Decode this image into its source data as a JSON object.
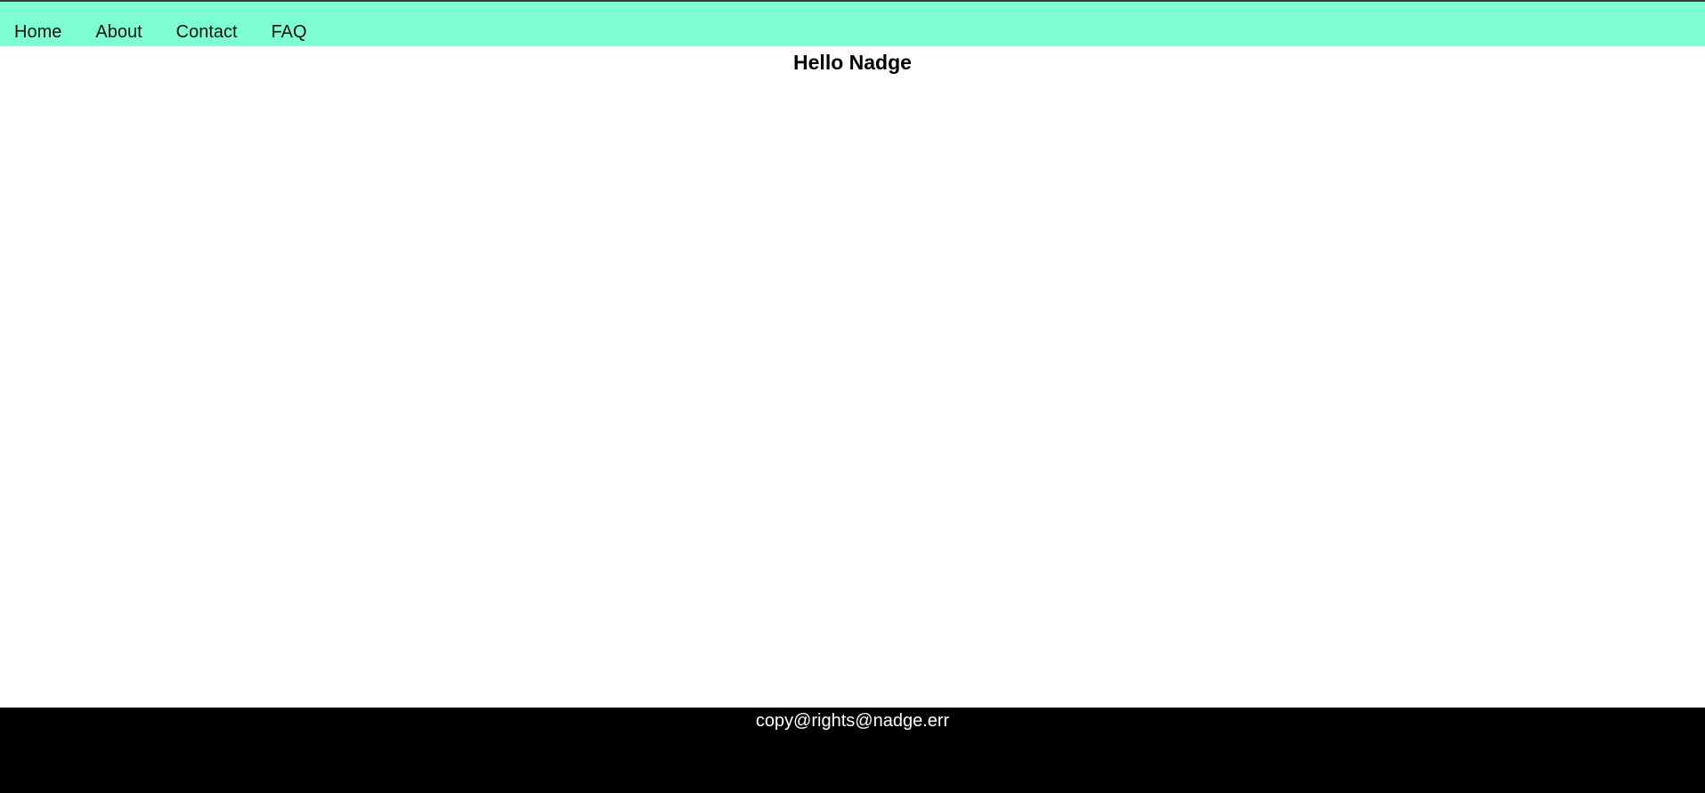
{
  "header": {
    "nav_items": [
      {
        "label": "Home"
      },
      {
        "label": "About"
      },
      {
        "label": "Contact"
      },
      {
        "label": "FAQ"
      }
    ]
  },
  "main": {
    "title": "Hello Nadge"
  },
  "footer": {
    "text": "copy@rights@nadge.err"
  },
  "colors": {
    "nav_background": "#7fffd4",
    "footer_background": "#000000",
    "page_background": "#ffffff"
  }
}
